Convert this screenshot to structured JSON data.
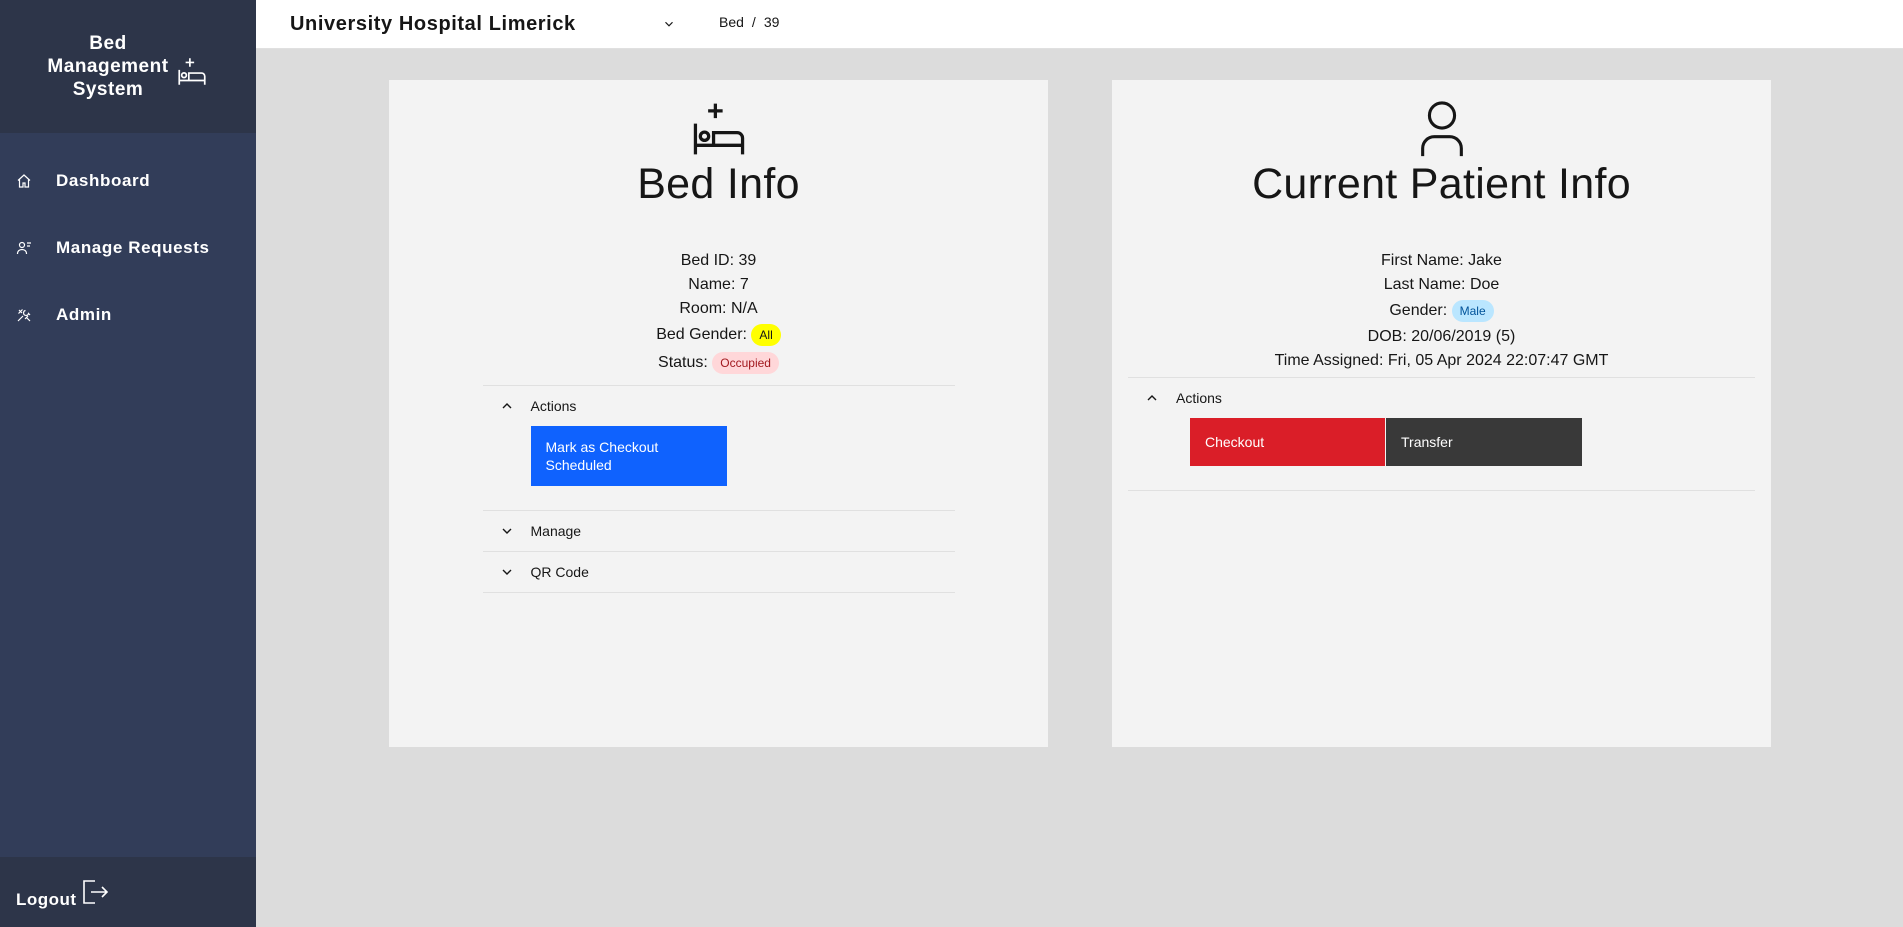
{
  "sidebar": {
    "brand_line1": "Bed",
    "brand_line2": "Management",
    "brand_line3": "System",
    "items": [
      {
        "label": "Dashboard",
        "icon": "home-icon"
      },
      {
        "label": "Manage Requests",
        "icon": "user-requests-icon"
      },
      {
        "label": "Admin",
        "icon": "tools-icon"
      }
    ],
    "logout_label": "Logout"
  },
  "header": {
    "hospital": "University Hospital Limerick",
    "breadcrumb": {
      "first": "Bed",
      "separator": "/",
      "second": "39"
    }
  },
  "bed_card": {
    "title": "Bed Info",
    "bed_id": "Bed ID: 39",
    "name": "Name: 7",
    "room": "Room: N/A",
    "gender_label": "Bed Gender:",
    "gender_tag": "All",
    "status_label": "Status:",
    "status_tag": "Occupied",
    "accordion": {
      "actions_label": "Actions",
      "mark_button": "Mark as Checkout Scheduled",
      "manage_label": "Manage",
      "qr_label": "QR Code"
    }
  },
  "patient_card": {
    "title": "Current Patient Info",
    "first_name": "First Name: Jake",
    "last_name": "Last Name: Doe",
    "gender_label": "Gender:",
    "gender_tag": "Male",
    "dob": "DOB: 20/06/2019 (5)",
    "time_assigned": "Time Assigned: Fri, 05 Apr 2024 22:07:47 GMT",
    "accordion": {
      "actions_label": "Actions",
      "checkout_button": "Checkout",
      "transfer_button": "Transfer"
    }
  },
  "colors": {
    "sidebar": "#323d59",
    "sidebar_brand": "#2d3549",
    "primary": "#0f62fe",
    "danger": "#da1e28",
    "secondary": "#393939",
    "tag_yellow": "#ffff00",
    "tag_red": "#ffd7d9",
    "tag_blue": "#bae6ff"
  }
}
